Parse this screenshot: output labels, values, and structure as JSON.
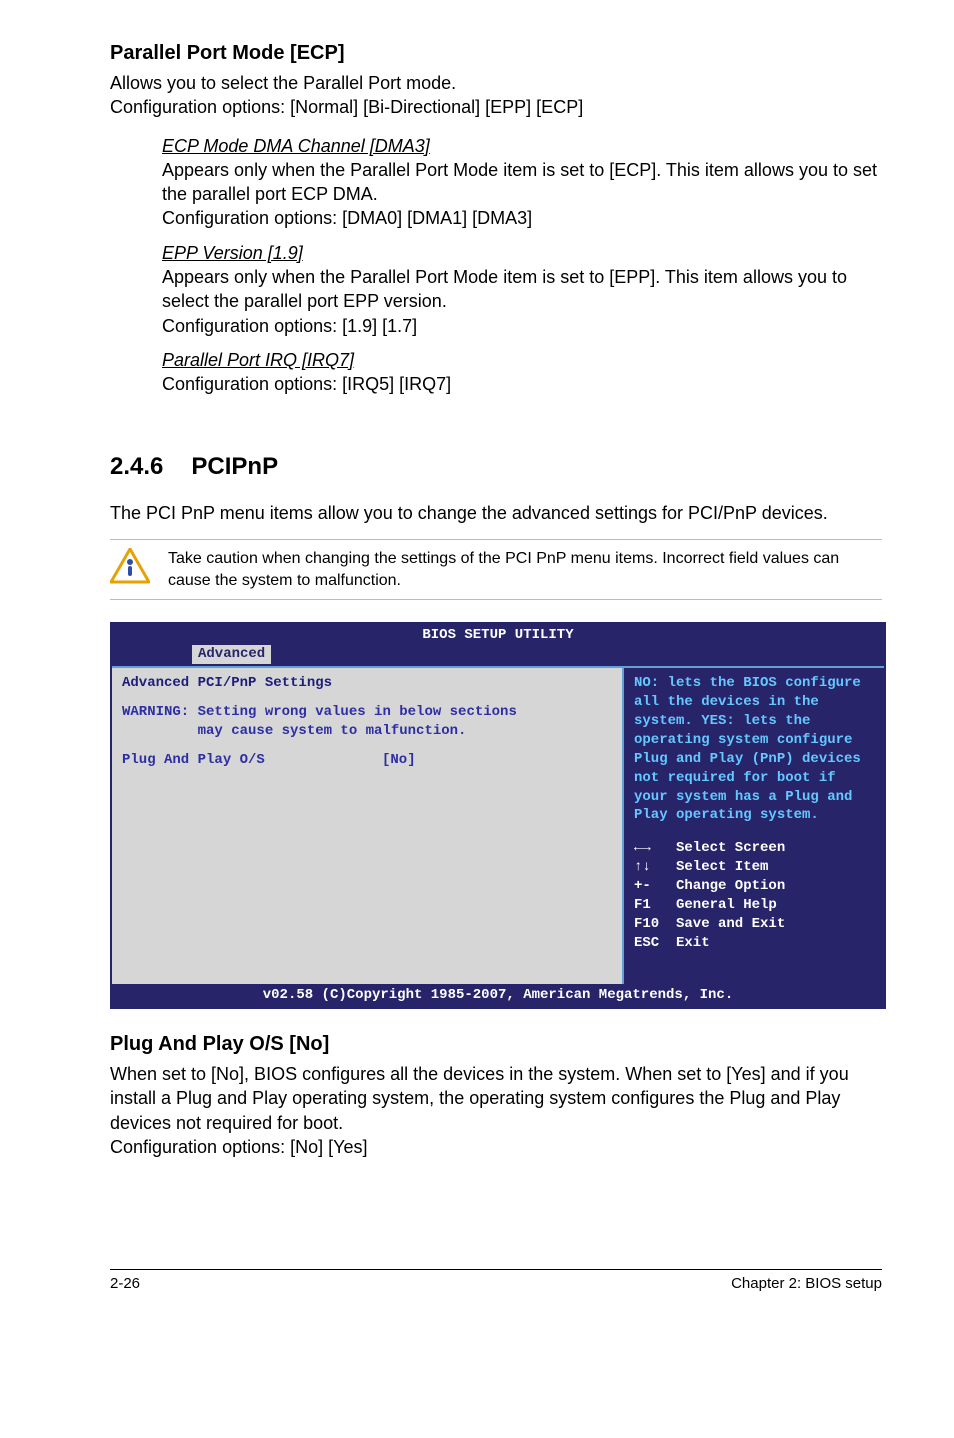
{
  "s1": {
    "heading": "Parallel Port Mode [ECP]",
    "p1": "Allows you to select the Parallel Port  mode.",
    "p2": "Configuration options: [Normal] [Bi-Directional] [EPP] [ECP]",
    "sub1": {
      "title": "ECP Mode DMA Channel [DMA3]",
      "l1": "Appears only when the Parallel Port Mode item is set to [ECP]. This item allows you to set the parallel port ECP DMA.",
      "l2": "Configuration options: [DMA0] [DMA1] [DMA3]"
    },
    "sub2": {
      "title": "EPP Version [1.9]",
      "l1": "Appears only when the Parallel Port Mode item is set to [EPP]. This item allows you to select the parallel port EPP version.",
      "l2": "Configuration options: [1.9] [1.7]"
    },
    "sub3": {
      "title": "Parallel Port IRQ [IRQ7]",
      "l1": "Configuration options: [IRQ5] [IRQ7]"
    }
  },
  "section": {
    "num": "2.4.6",
    "title": "PCIPnP",
    "intro": "The PCI PnP menu items allow you to change the advanced settings for PCI/PnP devices.",
    "caution": "Take caution when changing the settings of the PCI PnP menu items. Incorrect field values can cause the system to malfunction."
  },
  "bios": {
    "title": "BIOS SETUP UTILITY",
    "tab": "Advanced",
    "left": {
      "hdr": "Advanced PCI/PnP Settings",
      "warn1": "WARNING: Setting wrong values in below sections",
      "warn2": "         may cause system to malfunction.",
      "row1_label": "Plug And Play O/S",
      "row1_value": "[No]"
    },
    "right": {
      "help": "NO: lets the BIOS configure all the devices in the system. YES: lets the operating system configure Plug and Play (PnP) devices not required for boot if your system has a Plug and Play operating system.",
      "nav": {
        "k1": "←→",
        "v1": "Select Screen",
        "k2": "↑↓",
        "v2": "Select Item",
        "k3": "+-",
        "v3": "Change Option",
        "k4": "F1",
        "v4": "General Help",
        "k5": "F10",
        "v5": "Save and Exit",
        "k6": "ESC",
        "v6": "Exit"
      }
    },
    "footer": "v02.58 (C)Copyright 1985-2007, American Megatrends, Inc."
  },
  "s2": {
    "heading": "Plug And Play O/S [No]",
    "p1": "When set to [No], BIOS configures all the devices in the system. When set to [Yes] and if you install a Plug and Play operating system, the operating system configures the Plug and Play devices not required for boot.",
    "p2": "Configuration options: [No] [Yes]"
  },
  "footer": {
    "left": "2-26",
    "right": "Chapter 2: BIOS setup"
  }
}
